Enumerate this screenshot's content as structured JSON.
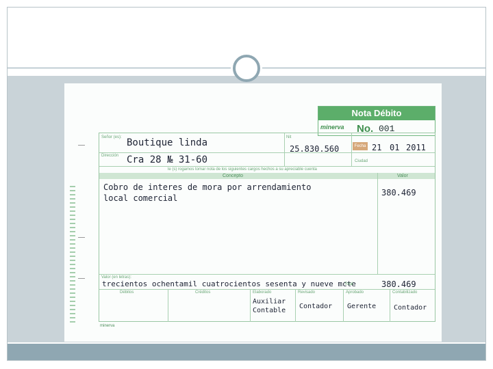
{
  "document": {
    "title": "Nota Débito",
    "brand": "minerva",
    "number_label": "No.",
    "number": "001",
    "labels": {
      "senor": "Señor (es):",
      "nit": "Nit",
      "direccion": "Dirección",
      "fecha": "Fecha",
      "ciudad": "Ciudad",
      "concepto": "Concepto",
      "valor": "Valor",
      "valor_letras": "Valor (en letras):",
      "cargo_note": "le (s) rogamos tomar nota de los siguientes cargos hechos a su apreciable cuenta",
      "debitos": "Débitos",
      "creditos": "Créditos",
      "elaborado": "Elaborado",
      "revisado": "Revisado",
      "aprobado": "Aprobado",
      "contabilizado": "Contabilizado",
      "total": "Total"
    },
    "client": "Boutique linda",
    "nit": "25.830.560",
    "address": "Cra 28 № 31-60",
    "date": {
      "day": "21",
      "month": "01",
      "year": "2011"
    },
    "concept_line1": "Cobro de interes de mora por arrendamiento",
    "concept_line2": "local comercial",
    "value": "380.469",
    "value_in_words": "trecientos ochentamil cuatrocientos sesenta y nueve mcte",
    "total_value": "380.469",
    "signatures": {
      "elaborado": "Auxiliar Contable",
      "revisado": "Contador",
      "aprobado": "Gerente",
      "contabilizado": "Contador"
    }
  }
}
